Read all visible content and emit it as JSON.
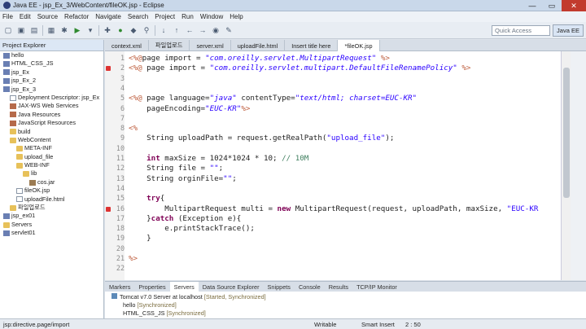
{
  "window": {
    "title": "Java EE - jsp_Ex_3/WebContent/fileOK.jsp - Eclipse"
  },
  "menu": [
    "File",
    "Edit",
    "Source",
    "Refactor",
    "Navigate",
    "Search",
    "Project",
    "Run",
    "Window",
    "Help"
  ],
  "toolbar": {
    "quick_access_placeholder": "Quick Access",
    "perspective": "Java EE"
  },
  "project_explorer": {
    "title": "Project Explorer",
    "items": [
      {
        "label": "hello",
        "indent": 0,
        "icon": "proj"
      },
      {
        "label": "HTML_CSS_JS",
        "indent": 0,
        "icon": "proj"
      },
      {
        "label": "jsp_Ex",
        "indent": 0,
        "icon": "proj"
      },
      {
        "label": "jsp_Ex_2",
        "indent": 0,
        "icon": "proj"
      },
      {
        "label": "jsp_Ex_3",
        "indent": 0,
        "icon": "proj"
      },
      {
        "label": "Deployment Descriptor: jsp_Ex",
        "indent": 1,
        "icon": "file"
      },
      {
        "label": "JAX-WS Web Services",
        "indent": 1,
        "icon": "lib"
      },
      {
        "label": "Java Resources",
        "indent": 1,
        "icon": "lib"
      },
      {
        "label": "JavaScript Resources",
        "indent": 1,
        "icon": "lib"
      },
      {
        "label": "build",
        "indent": 1,
        "icon": "folder"
      },
      {
        "label": "WebContent",
        "indent": 1,
        "icon": "folder"
      },
      {
        "label": "META-INF",
        "indent": 2,
        "icon": "folder"
      },
      {
        "label": "upload_file",
        "indent": 2,
        "icon": "folder"
      },
      {
        "label": "WEB-INF",
        "indent": 2,
        "icon": "folder"
      },
      {
        "label": "lib",
        "indent": 3,
        "icon": "folder"
      },
      {
        "label": "cos.jar",
        "indent": 4,
        "icon": "jar"
      },
      {
        "label": "fileOK.jsp",
        "indent": 2,
        "icon": "file"
      },
      {
        "label": "uploadFile.html",
        "indent": 2,
        "icon": "file"
      },
      {
        "label": "파일업로드",
        "indent": 1,
        "icon": "folder"
      },
      {
        "label": "jsp_ex01",
        "indent": 0,
        "icon": "proj"
      },
      {
        "label": "Servers",
        "indent": 0,
        "icon": "folder"
      },
      {
        "label": "servlet01",
        "indent": 0,
        "icon": "proj"
      }
    ]
  },
  "editor_tabs": [
    {
      "label": "context.xml",
      "active": false
    },
    {
      "label": "파일업로드",
      "active": false
    },
    {
      "label": "server.xml",
      "active": false
    },
    {
      "label": "uploadFile.html",
      "active": false
    },
    {
      "label": "Insert title here",
      "active": false
    },
    {
      "label": "*fileOK.jsp",
      "active": true
    }
  ],
  "code_lines": [
    {
      "n": "1",
      "err": false,
      "html": "<span class=\"tag\">&lt;%@</span>page import = <span class=\"ital\">\"com.oreilly.servlet.MultipartRequest\"</span> <span class=\"tag\">%&gt;</span>"
    },
    {
      "n": "2",
      "err": true,
      "html": "<span class=\"tag\">&lt;%@</span> page import = <span class=\"ital\">\"com.oreilly.servlet.multipart.DefaultFileRenamePolicy\"</span> <span class=\"tag\">%&gt;</span>"
    },
    {
      "n": "3",
      "err": false,
      "html": ""
    },
    {
      "n": "4",
      "err": false,
      "html": ""
    },
    {
      "n": "5",
      "err": false,
      "html": "<span class=\"tag\">&lt;%@</span> page language=<span class=\"ital\">\"java\"</span> contentType=<span class=\"ital\">\"text/html; charset=EUC-KR\"</span>"
    },
    {
      "n": "6",
      "err": false,
      "html": "    pageEncoding=<span class=\"ital\">\"EUC-KR\"</span><span class=\"tag\">%&gt;</span>"
    },
    {
      "n": "7",
      "err": false,
      "html": ""
    },
    {
      "n": "8",
      "err": false,
      "html": "<span class=\"tag\">&lt;%</span>"
    },
    {
      "n": "9",
      "err": false,
      "html": "    String uploadPath = request.getRealPath(<span class=\"str\">\"upload_file\"</span>);"
    },
    {
      "n": "10",
      "err": false,
      "html": ""
    },
    {
      "n": "11",
      "err": false,
      "html": "    <span class=\"kw\">int</span> maxSize = 1024*1024 * 10; <span class=\"cmt\">// 10M</span>"
    },
    {
      "n": "12",
      "err": false,
      "html": "    String file = <span class=\"str\">\"\"</span>;"
    },
    {
      "n": "13",
      "err": false,
      "html": "    String orginFile=<span class=\"str\">\"\"</span>;"
    },
    {
      "n": "14",
      "err": false,
      "html": ""
    },
    {
      "n": "15",
      "err": false,
      "html": "    <span class=\"kw\">try</span>{"
    },
    {
      "n": "16",
      "err": true,
      "html": "        MultipartRequest multi = <span class=\"kw\">new</span> MultipartRequest(request, uploadPath, maxSize, <span class=\"str\">\"EUC-KR</span>"
    },
    {
      "n": "17",
      "err": false,
      "html": "    }<span class=\"kw\">catch</span> (Exception e){"
    },
    {
      "n": "18",
      "err": false,
      "html": "        e.printStackTrace();"
    },
    {
      "n": "19",
      "err": false,
      "html": "    }"
    },
    {
      "n": "20",
      "err": false,
      "html": ""
    },
    {
      "n": "21",
      "err": false,
      "html": "<span class=\"tag\">%&gt;</span>"
    },
    {
      "n": "22",
      "err": false,
      "html": ""
    }
  ],
  "bottom_tabs": [
    {
      "label": "Markers",
      "active": false
    },
    {
      "label": "Properties",
      "active": false
    },
    {
      "label": "Servers",
      "active": true
    },
    {
      "label": "Data Source Explorer",
      "active": false
    },
    {
      "label": "Snippets",
      "active": false
    },
    {
      "label": "Console",
      "active": false
    },
    {
      "label": "Results",
      "active": false
    },
    {
      "label": "TCP/IP Monitor",
      "active": false
    }
  ],
  "servers": {
    "line1": "Tomcat v7.0 Server at localhost",
    "line1_status": "[Started, Synchronized]",
    "line2": "hello",
    "line2_status": "[Synchronized]",
    "line3": "HTML_CSS_JS",
    "line3_status": "[Synchronized]"
  },
  "status": {
    "path": "jsp:directive.page/import",
    "writable": "Writable",
    "insert_mode": "Smart Insert",
    "position": "2 : 50"
  },
  "colors": {
    "keyword": "#7f0055",
    "string": "#2a00ff",
    "jsp_tag": "#bf5f3f",
    "comment": "#3f7f5f",
    "error": "#dd3333"
  }
}
